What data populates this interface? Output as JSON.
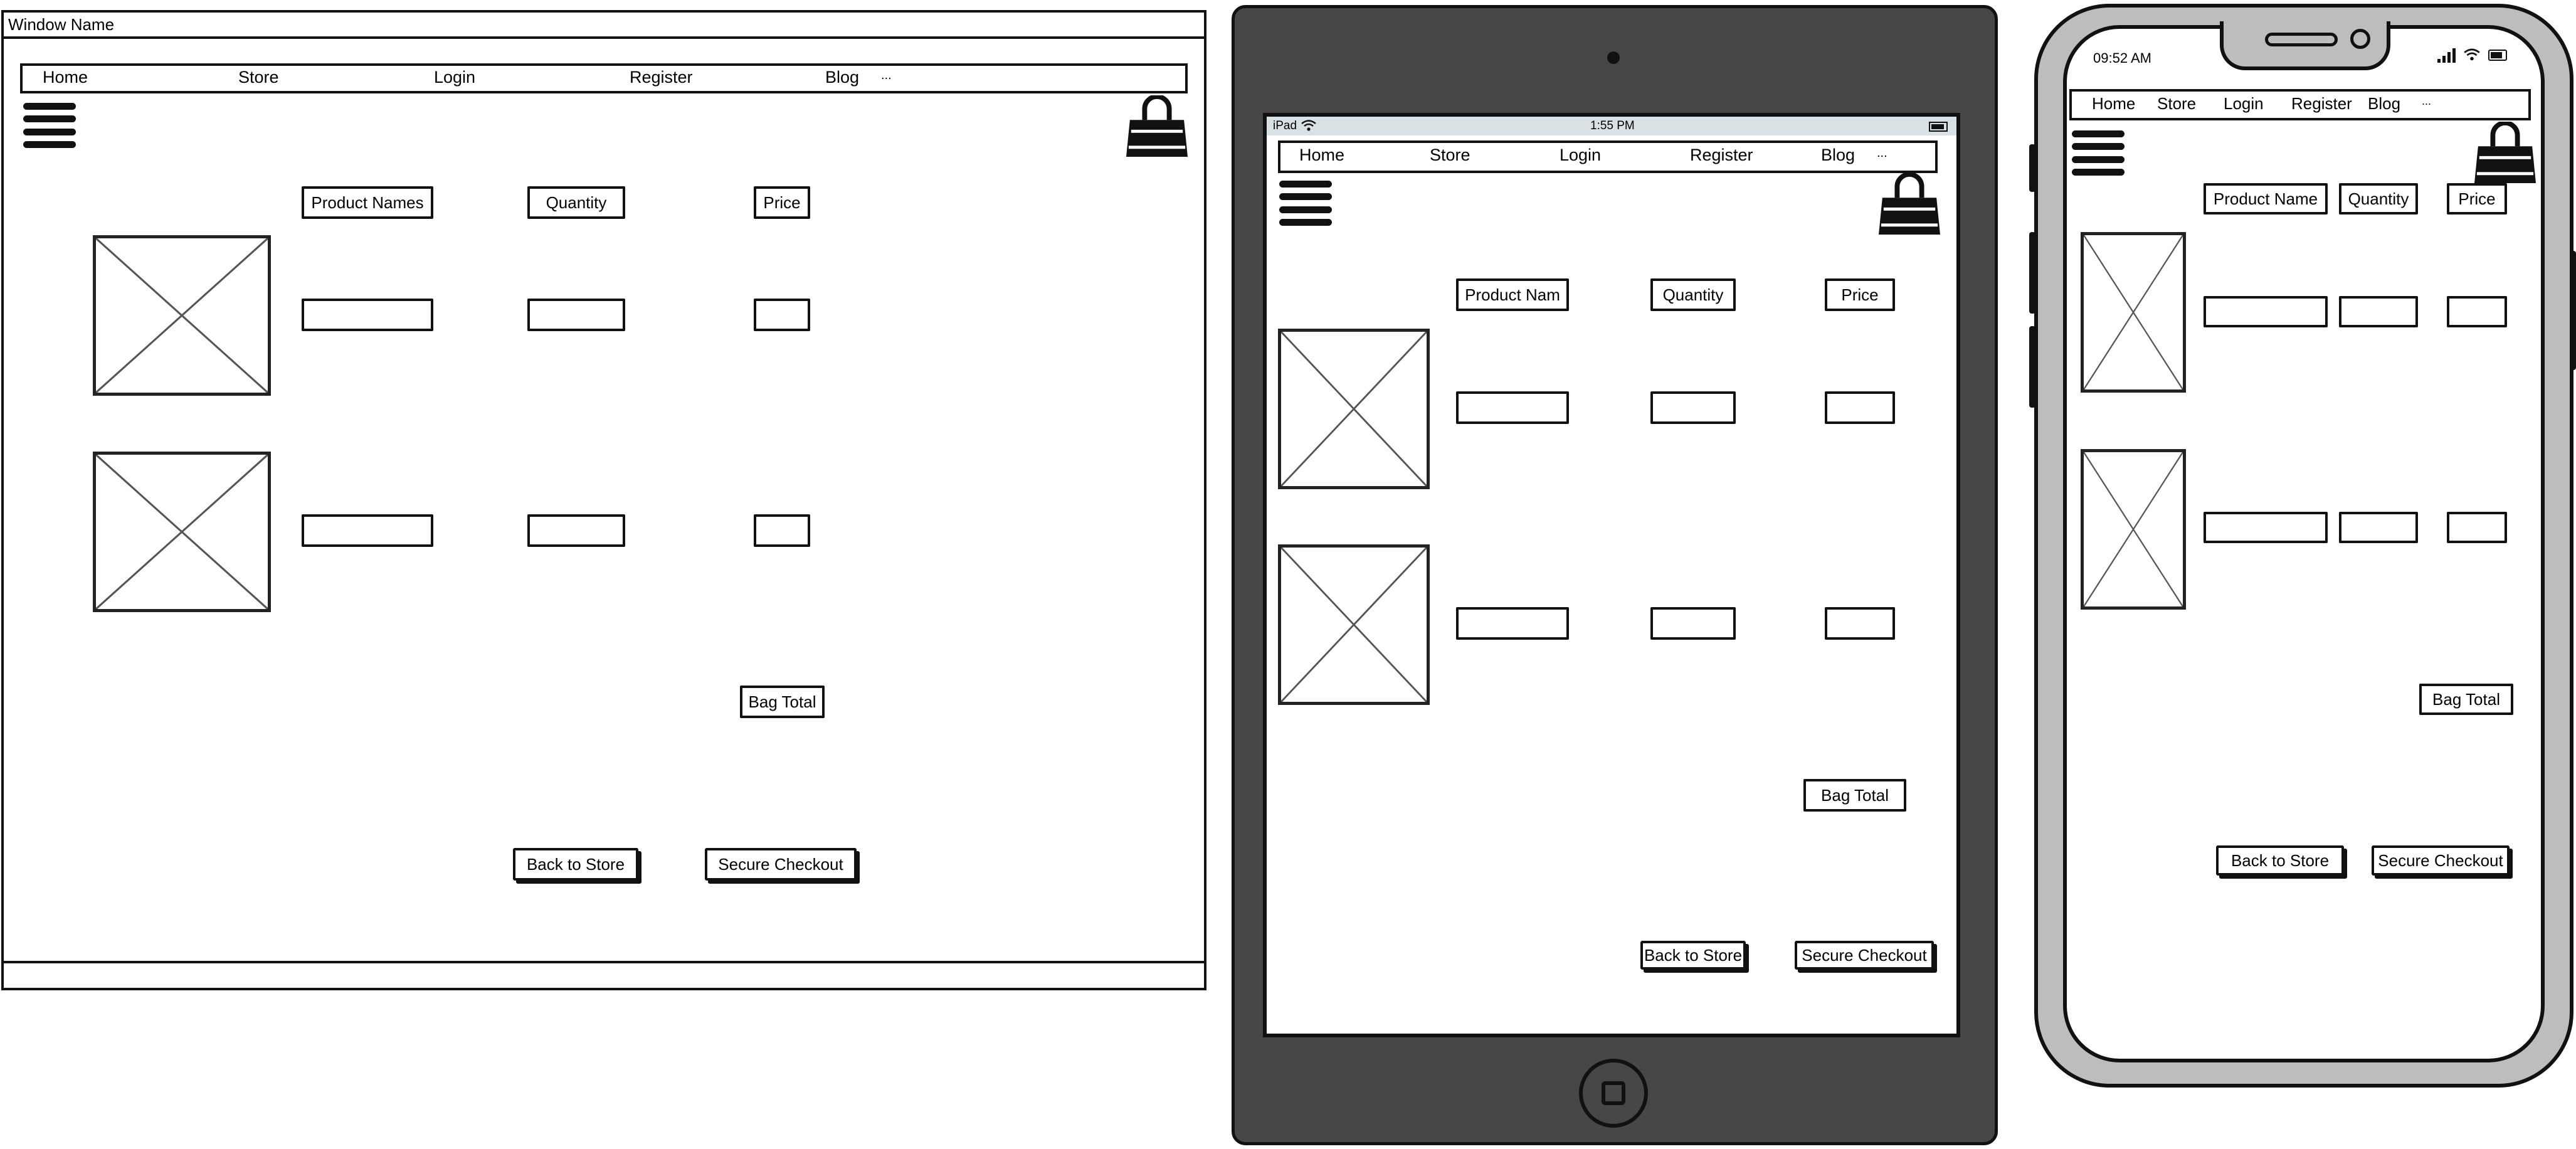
{
  "desktop": {
    "window_title": "Window Name",
    "nav": [
      "Home",
      "Store",
      "Login",
      "Register",
      "Blog",
      "..."
    ],
    "column_headers": [
      "Product Names",
      "Quantity",
      "Price"
    ],
    "bag_total_label": "Bag Total",
    "back_button": "Back to Store",
    "checkout_button": "Secure Checkout"
  },
  "tablet": {
    "status_device": "iPad",
    "status_time": "1:55 PM",
    "nav": [
      "Home",
      "Store",
      "Login",
      "Register",
      "Blog",
      "..."
    ],
    "column_headers": [
      "Product Nam",
      "Quantity",
      "Price"
    ],
    "bag_total_label": "Bag Total",
    "back_button": "Back to Store",
    "checkout_button": "Secure Checkout"
  },
  "phone": {
    "status_time": "09:52 AM",
    "nav": [
      "Home",
      "Store",
      "Login",
      "Register",
      "Blog",
      "..."
    ],
    "column_headers": [
      "Product Name",
      "Quantity",
      "Price"
    ],
    "bag_total_label": "Bag Total",
    "back_button": "Back to Store",
    "checkout_button": "Secure Checkout"
  },
  "icons": {
    "menu": "hamburger-menu-icon",
    "bag": "shopping-bag-icon",
    "image_placeholder": "image-placeholder-icon",
    "wifi": "wifi-icon",
    "signal": "cell-signal-icon",
    "battery": "battery-icon",
    "home_button": "home-button-icon",
    "camera": "camera-icon"
  },
  "colors": {
    "tablet_bezel": "#474747",
    "phone_frame": "#bdbdbd",
    "status_bar": "#d9e1e4",
    "ink": "#111111"
  }
}
